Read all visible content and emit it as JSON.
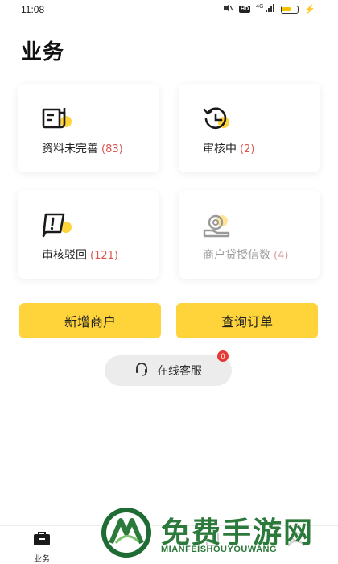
{
  "status_bar": {
    "time": "11:08",
    "signal": "4G",
    "hd": "HD"
  },
  "page_title": "业务",
  "cards": [
    {
      "label": "资料未完善",
      "count": "(83)",
      "icon": "document-alert-icon"
    },
    {
      "label": "审核中",
      "count": "(2)",
      "icon": "clock-rewind-icon"
    },
    {
      "label": "审核驳回",
      "count": "(121)",
      "icon": "reject-alert-icon"
    },
    {
      "label": "商户贷授信数",
      "count": "(4)",
      "icon": "credit-coin-icon"
    }
  ],
  "actions": {
    "add_merchant": "新增商户",
    "query_order": "查询订单"
  },
  "service": {
    "label": "在线客服",
    "badge": "0"
  },
  "bottom_nav": {
    "business": "业务"
  },
  "watermark": {
    "title": "免费手游网",
    "subtitle": "MIANFEISHOUYOUWANG"
  },
  "colors": {
    "accent": "#ffd33a",
    "count_red": "#d9534f",
    "badge_red": "#e53935"
  }
}
